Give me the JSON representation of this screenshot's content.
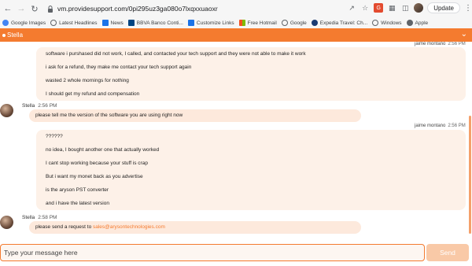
{
  "browser": {
    "url": "vm.providesupport.com/0pi295uz3ga080o7lxqxxuaoxr",
    "update_label": "Update",
    "bookmarks": [
      {
        "label": "Google Images",
        "color": "#4285f4"
      },
      {
        "label": "Latest Headlines",
        "color": "#5f6368"
      },
      {
        "label": "News",
        "color": "#1a73e8"
      },
      {
        "label": "BBVA Banco Conti...",
        "color": "#004481"
      },
      {
        "label": "Customize Links",
        "color": "#1a73e8"
      },
      {
        "label": "Free Hotmail",
        "color": "#f25022"
      },
      {
        "label": "Google",
        "color": "#5f6368"
      },
      {
        "label": "Expedia Travel: Ch...",
        "color": "#1a3b73"
      },
      {
        "label": "Windows",
        "color": "#5f6368"
      },
      {
        "label": "Apple",
        "color": "#5f6368"
      }
    ]
  },
  "chat": {
    "title": "Stella",
    "accent_color": "#f47b2f",
    "messages": [
      {
        "sender": "jaime montano",
        "time": "2:56 PM",
        "role": "user",
        "lines": [
          "software i purshased did not work, I called, and contacted your tech support and they were not able to make it work",
          "i ask for a refund, they make me contact your tech support again",
          "wasted 2 whole mornings for nothing",
          "I should get my refund and compensation"
        ]
      },
      {
        "sender": "Stella",
        "time": "2:56 PM",
        "role": "agent",
        "text": "please tell me the version of the software you are using right now"
      },
      {
        "sender": "jaime montano",
        "time": "2:56 PM",
        "role": "user",
        "lines": [
          "??????",
          "no idea, I bought another one that actually worked",
          "I cant stop working because your stuff is crap",
          "But i want my monet back as you advertise",
          "is the aryson PST converter",
          "and i have the latest version"
        ]
      },
      {
        "sender": "Stella",
        "time": "2:58 PM",
        "role": "agent",
        "text_before": "please send a request to ",
        "email": "sales@arysontechnologies.com"
      }
    ],
    "input_placeholder": "Type your message here",
    "send_label": "Send"
  }
}
